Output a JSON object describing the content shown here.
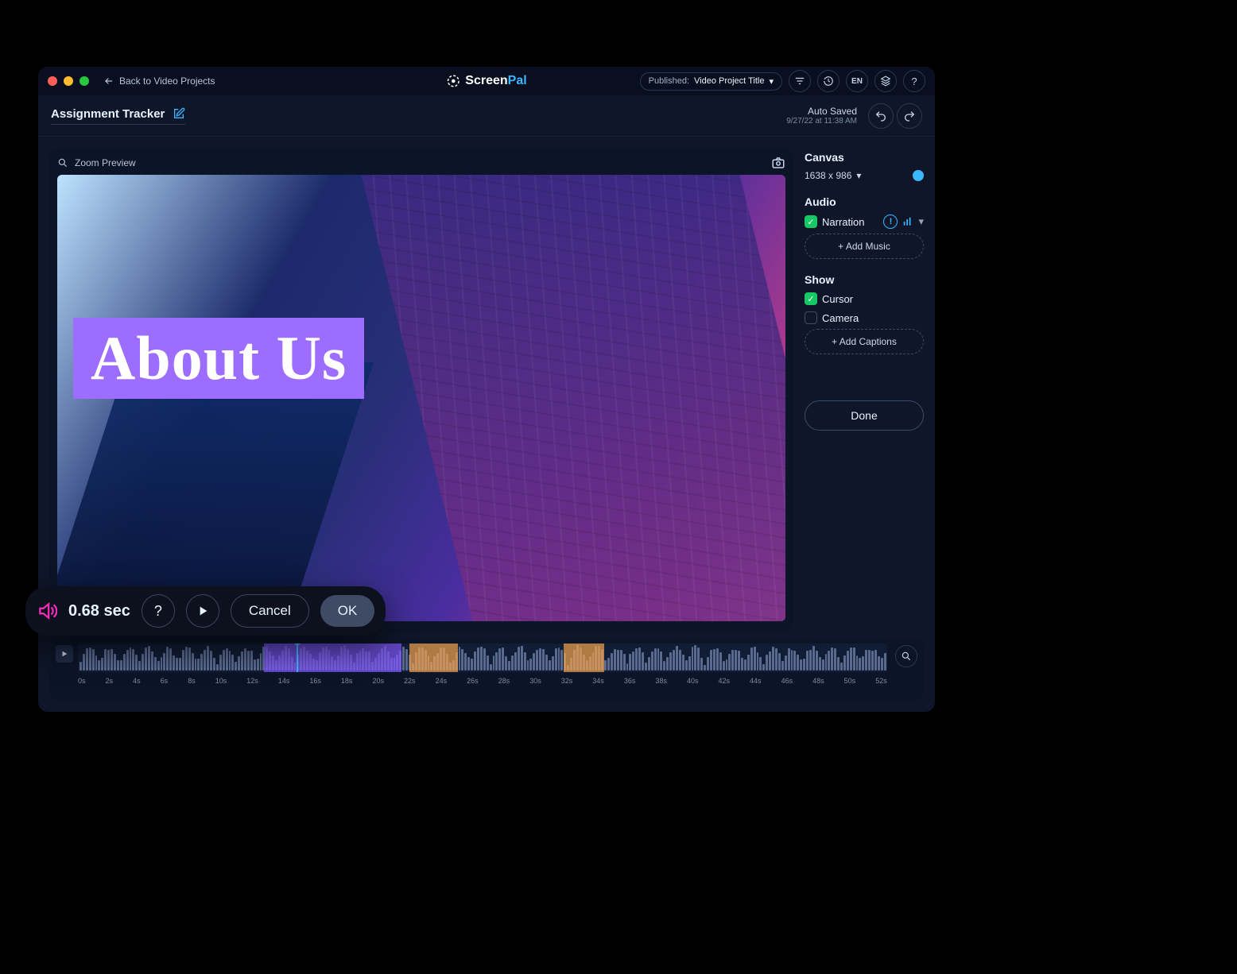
{
  "titlebar": {
    "back_label": "Back to Video Projects",
    "brand_a": "Screen",
    "brand_b": "Pal",
    "published_label": "Published:",
    "published_title": "Video Project Title",
    "lang": "EN"
  },
  "header": {
    "project_name": "Assignment Tracker",
    "autosaved": "Auto Saved",
    "autosaved_time": "9/27/22 at 11:38 AM"
  },
  "preview": {
    "zoom_label": "Zoom Preview",
    "overlay_text": "About Us"
  },
  "side": {
    "canvas_title": "Canvas",
    "canvas_dims": "1638 x 986",
    "audio_title": "Audio",
    "narration_label": "Narration",
    "add_music": "+  Add Music",
    "show_title": "Show",
    "cursor_label": "Cursor",
    "camera_label": "Camera",
    "add_captions": "+  Add Captions",
    "done": "Done"
  },
  "timeline": {
    "ticks": [
      "0s",
      "2s",
      "4s",
      "6s",
      "8s",
      "10s",
      "12s",
      "14s",
      "16s",
      "18s",
      "20s",
      "22s",
      "24s",
      "26s",
      "28s",
      "30s",
      "32s",
      "34s",
      "36s",
      "38s",
      "40s",
      "42s",
      "44s",
      "46s",
      "48s",
      "50s",
      "52s"
    ]
  },
  "editpanel": {
    "duration": "0.68 sec",
    "help": "?",
    "cancel": "Cancel",
    "ok": "OK"
  }
}
